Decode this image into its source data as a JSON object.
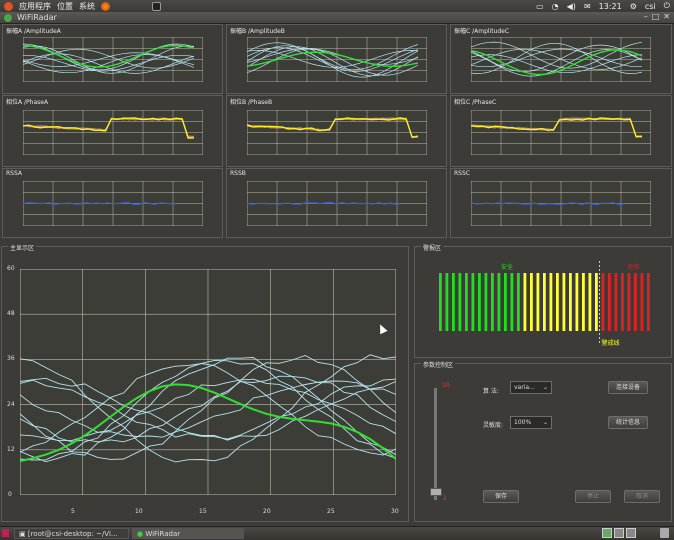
{
  "topbar": {
    "menu": [
      "应用程序",
      "位置",
      "系统"
    ],
    "clock": "13:21",
    "user": "csi"
  },
  "window": {
    "title": "WiFiRadar"
  },
  "small_plots": [
    {
      "title": "振幅A /AmplitudeA"
    },
    {
      "title": "振幅B /AmplitudeB"
    },
    {
      "title": "振幅C /AmplitudeC"
    },
    {
      "title": "相位A /PhaseA"
    },
    {
      "title": "相位B /PhaseB"
    },
    {
      "title": "相位C /PhaseC"
    },
    {
      "title": "RSSA"
    },
    {
      "title": "RSSB"
    },
    {
      "title": "RSSC"
    }
  ],
  "main": {
    "group_title": "主显示区",
    "y_ticks": [
      "0",
      "12",
      "24",
      "36",
      "48",
      "60"
    ],
    "x_ticks": [
      "5",
      "10",
      "15",
      "20",
      "25",
      "30"
    ]
  },
  "alarm": {
    "group_title": "警报区",
    "safe_label": "安全",
    "danger_label": "危险",
    "threshold_label": "警戒线",
    "green_bars": 13,
    "yellow_bars": 12,
    "red_bars": 8,
    "colors": {
      "green": "#22dd22",
      "yellow": "#ffff33",
      "red": "#dd2222"
    }
  },
  "control": {
    "group_title": "参数控制区",
    "slider_max": "10",
    "slider_min": "1",
    "slider_level": 0.08,
    "field1_label": "算 法:",
    "field1_value": "varia...",
    "field2_label": "灵敏度:",
    "field2_value": "100%",
    "btn_connect": "连接设备",
    "btn_stats": "统计信息",
    "btn_save": "保存",
    "btn_stop": "停止",
    "btn_cancel": "取消"
  },
  "taskbar": {
    "tasks": [
      "[root@csi-desktop: ~/Vi...",
      "WiFiRadar"
    ]
  },
  "colors": {
    "plot_bg": "#3d3d38",
    "grid": "#bdbdb0",
    "green": "#33dd33",
    "cyan": "#b7e3ee",
    "yellow": "#ffee22",
    "rss": "#3a5fd0"
  }
}
